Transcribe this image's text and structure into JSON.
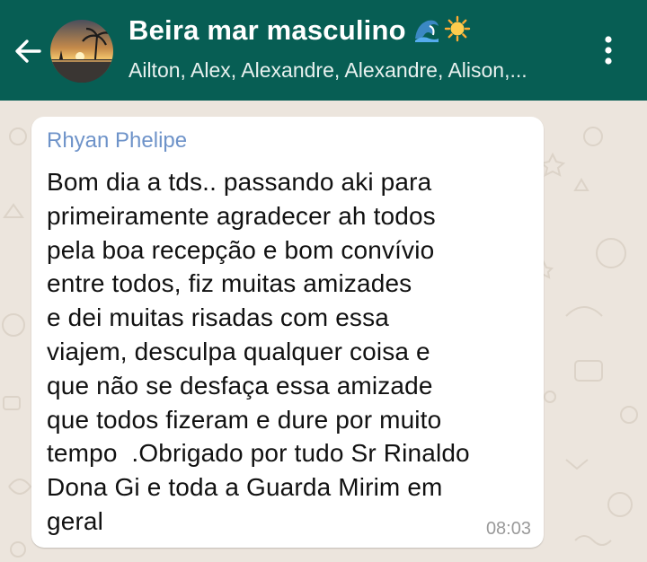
{
  "header": {
    "title": "Beira mar masculino",
    "title_icons": [
      "wave-emoji",
      "sun-emoji"
    ],
    "subtitle": "Ailton, Alex, Alexandre, Alexandre, Alison,...",
    "color": "#075e54"
  },
  "message": {
    "sender": "Rhyan Phelipe",
    "sender_color": "#6e93c9",
    "lines": [
      "Bom dia a tds.. passando aki para",
      "primeiramente agradecer ah todos",
      "pela boa recepção e bom convívio",
      "entre todos, fiz muitas amizades",
      "e dei muitas risadas com essa",
      "viajem, desculpa qualquer coisa e",
      "que não se desfaça essa amizade",
      "que todos fizeram e dure por muito",
      "tempo  .Obrigado por tudo Sr Rinaldo",
      "Dona Gi e toda a Guarda Mirim em",
      "geral"
    ],
    "time": "08:03"
  },
  "icons": {
    "back": "arrow-left-icon",
    "menu": "more-vertical-icon",
    "avatar": "sunset-beach-avatar"
  }
}
